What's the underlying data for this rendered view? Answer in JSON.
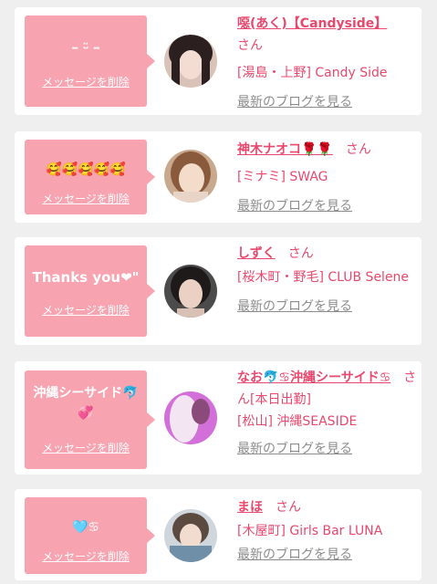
{
  "favorites": [
    {
      "message": "ｰ ᵕ̈ ｰ",
      "delete_label": "メッセージを削除",
      "name": "噁(あく)【Candyside】",
      "honorific": "さん",
      "shop": "[湯島・上野] Candy Side",
      "blog_link": "最新のブログを見る"
    },
    {
      "message": "🥰🥰🥰🥰🥰",
      "delete_label": "メッセージを削除",
      "name": "神木ナオコ🌹🌹",
      "honorific": "さん",
      "shop": "[ミナミ] SWAG",
      "blog_link": "最新のブログを見る"
    },
    {
      "message": "Thanks you❤︎\"",
      "delete_label": "メッセージを削除",
      "name": "しずく",
      "honorific": "さん",
      "shop": "[桜木町・野毛] CLUB Selene",
      "blog_link": "最新のブログを見る"
    },
    {
      "message": "沖縄シーサイド🐬💞",
      "delete_label": "メッセージを削除",
      "name": "なお🐬♋︎沖縄シーサイド♋︎",
      "honorific": "さん[本日出勤]",
      "shop": "[松山] 沖縄SEASIDE",
      "blog_link": "最新のブログを見る"
    },
    {
      "message": "🩵♋︎",
      "delete_label": "メッセージを削除",
      "name": "まほ",
      "honorific": "さん",
      "shop": "[木屋町] Girls Bar LUNA",
      "blog_link": "最新のブログを見る"
    }
  ]
}
